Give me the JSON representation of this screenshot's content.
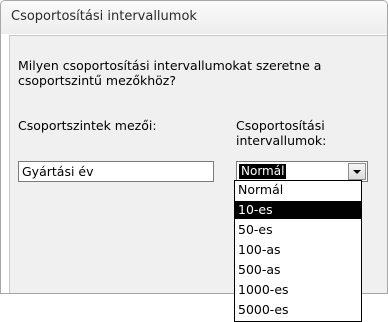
{
  "window": {
    "title": "Csoportosítási intervallumok"
  },
  "dialog": {
    "question_line1": "Milyen csoportosítási intervallumokat szeretne a",
    "question_line2": "csoportszintű mezőkhöz?",
    "group_fields_label": "Csoportszintek mezői:",
    "intervals_label_line1": "Csoportosítási",
    "intervals_label_line2": "intervallumok:",
    "group_field_value": "Gyártási év",
    "interval_selected": "Normál",
    "interval_options": [
      "Normál",
      "10-es",
      "50-es",
      "100-as",
      "500-as",
      "1000-es",
      "5000-es"
    ],
    "highlighted_option": "10-es"
  },
  "colors": {
    "selection": "#000000",
    "dialog_bg": "#f0f0f0",
    "title_text": "#2a2a2a"
  }
}
